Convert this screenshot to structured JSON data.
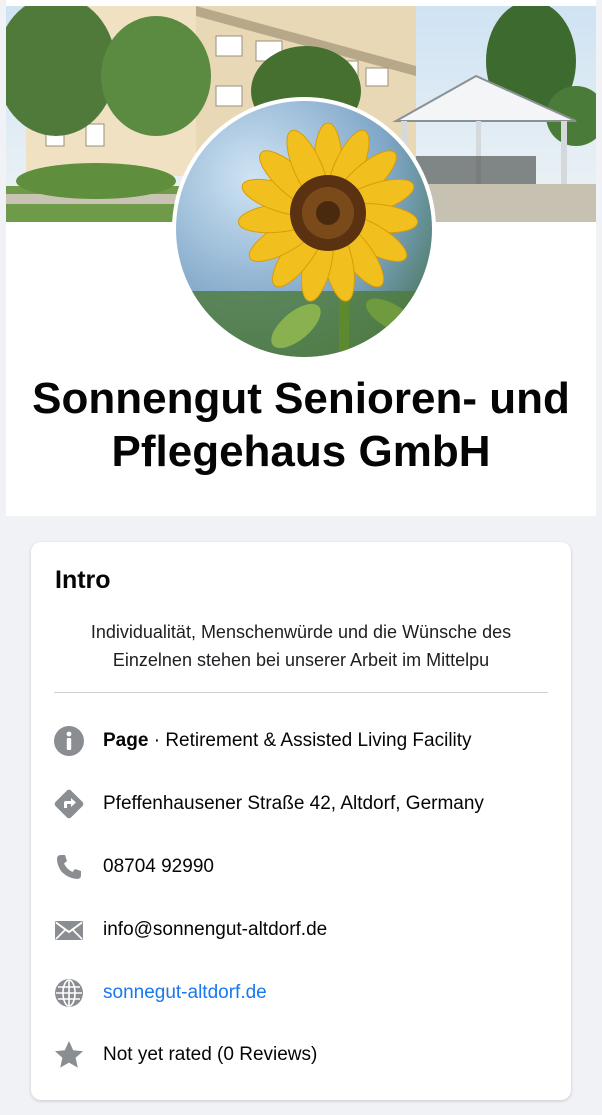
{
  "profile": {
    "name": "Sonnengut Senioren- und Pflegehaus GmbH"
  },
  "intro": {
    "title": "Intro",
    "bio": "Individualität, Menschenwürde und die Wünsche des Einzelnen stehen bei unserer Arbeit im Mittelpu",
    "category_label": "Page",
    "category_separator": " · ",
    "category_value": "Retirement & Assisted Living Facility",
    "address": "Pfeffenhausener Straße 42, Altdorf, Germany",
    "phone": "08704 92990",
    "email": "info@sonnengut-altdorf.de",
    "website": "sonnegut-altdorf.de",
    "rating": "Not yet rated (0 Reviews)"
  },
  "icons": {
    "info": "info-icon",
    "address": "directions-icon",
    "phone": "phone-icon",
    "email": "envelope-icon",
    "website": "globe-icon",
    "rating": "star-icon"
  },
  "colors": {
    "background": "#f0f2f5",
    "icon": "#8a8d91",
    "link": "#1877f2",
    "text": "#050505"
  }
}
